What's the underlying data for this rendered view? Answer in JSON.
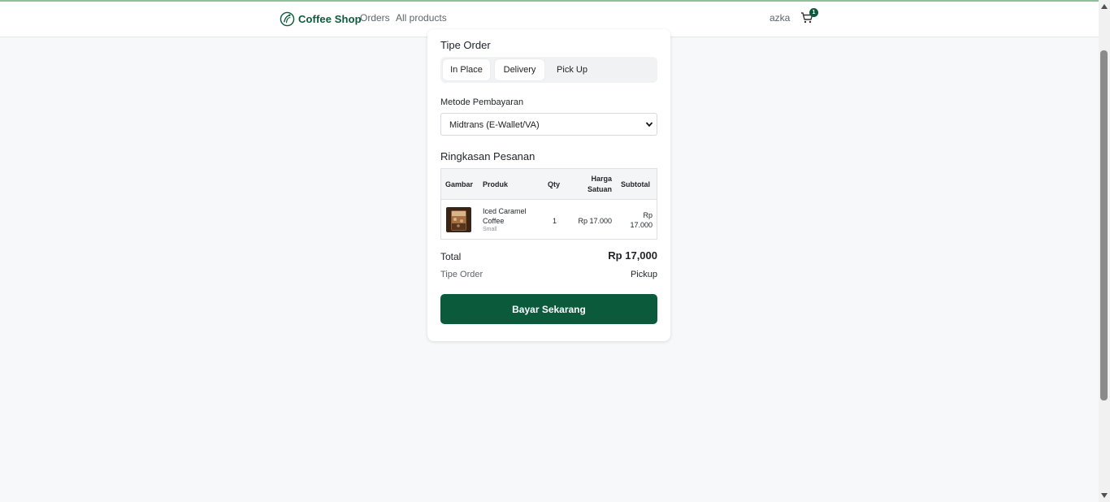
{
  "app": {
    "brand_name": "Coffee Shop",
    "accent_color": "#0c5a3c"
  },
  "nav": {
    "orders": "Orders",
    "all_products": "All products",
    "user": "azka",
    "cart_count": "1",
    "cart_icon": "shopping-cart-icon"
  },
  "order_type": {
    "title": "Tipe Order",
    "options": [
      "In Place",
      "Delivery",
      "Pick Up"
    ]
  },
  "payment": {
    "label": "Metode Pembayaran",
    "selected": "Midtrans (E-Wallet/VA)"
  },
  "summary": {
    "title": "Ringkasan Pesanan",
    "headers": {
      "gambar": "Gambar",
      "produk": "Produk",
      "qty": "Qty",
      "harga": "Harga Satuan",
      "subtotal": "Subtotal"
    },
    "rows": [
      {
        "name": "Iced Caramel Coffee",
        "size": "Small",
        "qty": "1",
        "price": "Rp 17.000",
        "subtotal": "Rp 17.000"
      }
    ]
  },
  "totals": {
    "total_label": "Total",
    "total_value": "Rp 17,000",
    "order_type_label": "Tipe Order",
    "order_type_value": "Pickup"
  },
  "actions": {
    "pay_button": "Bayar Sekarang"
  }
}
